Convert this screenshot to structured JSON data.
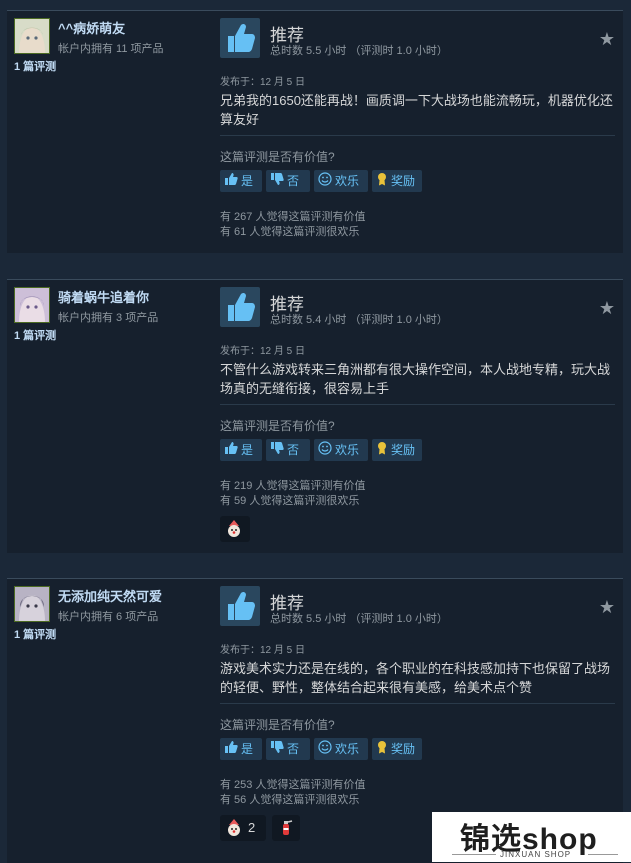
{
  "reviews": [
    {
      "user": {
        "name": "^^病娇萌友",
        "owns": "帐户内拥有 11 项产品",
        "review_count": "1 篇评测"
      },
      "verdict": "推荐",
      "hours": "总时数 5.5 小时 （评测时 1.0 小时）",
      "posted": "发布于：12 月 5 日",
      "body": "兄弟我的1650还能再战！画质调一下大战场也能流畅玩，机器优化还算友好",
      "helpful_question": "这篇评测是否有价值?",
      "buttons": {
        "yes": "是",
        "no": "否",
        "funny": "欢乐",
        "award": "奖励"
      },
      "helpful_count": "有 267 人觉得这篇评测有价值",
      "funny_count": "有 61 人觉得这篇评测很欢乐",
      "awards": []
    },
    {
      "user": {
        "name": "骑着蜗牛追着你",
        "owns": "帐户内拥有 3 项产品",
        "review_count": "1 篇评测"
      },
      "verdict": "推荐",
      "hours": "总时数 5.4 小时 （评测时 1.0 小时）",
      "posted": "发布于：12 月 5 日",
      "body": "不管什么游戏转来三角洲都有很大操作空间，本人战地专精，玩大战场真的无缝衔接，很容易上手",
      "helpful_question": "这篇评测是否有价值?",
      "buttons": {
        "yes": "是",
        "no": "否",
        "funny": "欢乐",
        "award": "奖励"
      },
      "helpful_count": "有 219 人觉得这篇评测有价值",
      "funny_count": "有 59 人觉得这篇评测很欢乐",
      "awards": [
        {
          "icon": "clown-award-icon",
          "count": ""
        }
      ]
    },
    {
      "user": {
        "name": "无添加纯天然可爱",
        "owns": "帐户内拥有 6 项产品",
        "review_count": "1 篇评测"
      },
      "verdict": "推荐",
      "hours": "总时数 5.5 小时 （评测时 1.0 小时）",
      "posted": "发布于：12 月 5 日",
      "body": "游戏美术实力还是在线的，各个职业的在科技感加持下也保留了战场的轻便、野性，整体结合起来很有美感，给美术点个赞",
      "helpful_question": "这篇评测是否有价值?",
      "buttons": {
        "yes": "是",
        "no": "否",
        "funny": "欢乐",
        "award": "奖励"
      },
      "helpful_count": "有 253 人觉得这篇评测有价值",
      "funny_count": "有 56 人觉得这篇评测很欢乐",
      "awards": [
        {
          "icon": "clown-award-icon",
          "count": "2"
        },
        {
          "icon": "fire-extinguisher-award-icon",
          "count": ""
        }
      ]
    }
  ],
  "watermark": {
    "brand": "锦选shop",
    "sub": "JINXUAN SHOP"
  },
  "colors": {
    "background": "#1b2838",
    "card": "#16202d",
    "accent": "#67c1f5",
    "thumb_bg": "#2a475e"
  },
  "icons": [
    "thumbs-up-icon",
    "thumbs-down-icon",
    "smiley-icon",
    "award-ribbon-icon",
    "star-icon"
  ]
}
